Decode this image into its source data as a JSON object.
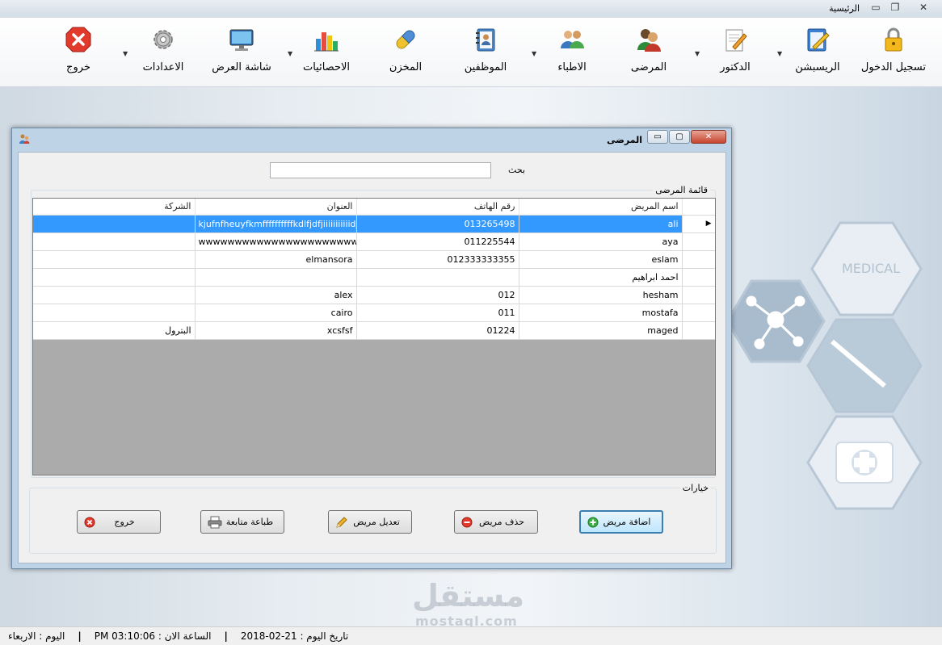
{
  "window": {
    "title": "الرئيسية"
  },
  "ribbon": {
    "items": [
      {
        "label": "تسجيل الدخول",
        "icon": "lock-icon"
      },
      {
        "label": "الريسبشن",
        "icon": "notepad-pen-icon"
      },
      {
        "label": "الدكتور",
        "icon": "document-edit-icon"
      },
      {
        "label": "المرضى",
        "icon": "people-icon"
      },
      {
        "label": "الاطباء",
        "icon": "users-icon"
      },
      {
        "label": "الموظفين",
        "icon": "address-book-icon"
      },
      {
        "label": "المخزن",
        "icon": "pill-icon"
      },
      {
        "label": "الاحصائيات",
        "icon": "bar-chart-icon"
      },
      {
        "label": "شاشة العرض",
        "icon": "monitor-icon"
      },
      {
        "label": "الاعدادات",
        "icon": "gear-icon"
      },
      {
        "label": "خروج",
        "icon": "close-red-icon"
      }
    ]
  },
  "background": {
    "medical_label": "MEDICAL"
  },
  "patients_window": {
    "title": "المرضى",
    "search_label": "بحث",
    "search_value": "",
    "list_group_title": "قائمة المرضى",
    "columns": [
      "اسم المريض",
      "رقم الهاتف",
      "العنوان",
      "الشركة"
    ],
    "rows": [
      {
        "name": "ali",
        "phone": "013265498",
        "address": "kjufnfheuyfkmffffffffffkdlfjdfjiiiiiiiiiiidjfd",
        "company": "",
        "selected": true
      },
      {
        "name": "aya",
        "phone": "011225544",
        "address": "wwwwwwwwwwwwwwwwwwwwwwwww...",
        "company": "",
        "selected": false
      },
      {
        "name": "eslam",
        "phone": "012333333355",
        "address": "elmansora",
        "company": "",
        "selected": false
      },
      {
        "name": "احمد ابراهيم",
        "phone": "",
        "address": "",
        "company": "",
        "selected": false
      },
      {
        "name": "hesham",
        "phone": "012",
        "address": "alex",
        "company": "",
        "selected": false
      },
      {
        "name": "mostafa",
        "phone": "011",
        "address": "cairo",
        "company": "",
        "selected": false
      },
      {
        "name": "maged",
        "phone": "01224",
        "address": "xcsfsf",
        "company": "البترول",
        "selected": false
      }
    ],
    "options_group_title": "خيارات",
    "buttons": {
      "add": "اضافة مريض",
      "delete": "حذف مريض",
      "edit": "تعديل مريض",
      "print": "طباعة متابعة",
      "exit": "خروج"
    }
  },
  "statusbar": {
    "date_label": "تاريخ اليوم :",
    "date_value": "2018-02-21",
    "time_label": "الساعة الان :",
    "time_value": "PM 03:10:06",
    "day_label": "اليوم :",
    "day_value": "الاربعاء"
  },
  "watermark": {
    "arabic": "مستقل",
    "latin": "mostaql.com"
  }
}
